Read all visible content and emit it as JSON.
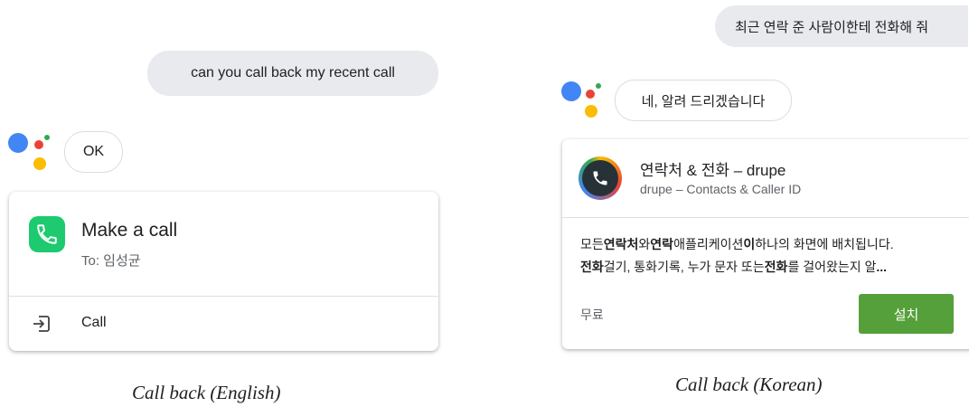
{
  "english": {
    "user_message": "can you call back my recent call",
    "assistant_reply": "OK",
    "card": {
      "icon": "phone-icon",
      "title": "Make a call",
      "subtitle": "To: 임성균",
      "action_icon": "exit-arrow-icon",
      "action_label": "Call"
    },
    "caption": "Call back (English)"
  },
  "korean": {
    "user_message": "최근 연락 준 사람이한테 전화해 줘",
    "assistant_reply": "네, 알려 드리겠습니다",
    "card": {
      "app_icon": "drupe-phone-icon",
      "app_title": "연락처 & 전화 – drupe",
      "app_subtitle": "drupe – Contacts & Caller ID",
      "description_line1": [
        {
          "text": "모든 ",
          "bold": false
        },
        {
          "text": "연락처",
          "bold": true
        },
        {
          "text": "와 ",
          "bold": false
        },
        {
          "text": "연락",
          "bold": true
        },
        {
          "text": " 애플리케이션",
          "bold": false
        },
        {
          "text": "이",
          "bold": true
        },
        {
          "text": " 하나의 화면에 배치됩니다.",
          "bold": false
        }
      ],
      "description_line2": [
        {
          "text": "전화",
          "bold": true
        },
        {
          "text": " 걸기, 통화기록, 누가 문자 또는 ",
          "bold": false
        },
        {
          "text": "전화",
          "bold": true
        },
        {
          "text": "를 걸어왔는지 알 ",
          "bold": false
        },
        {
          "text": "...",
          "bold": true
        }
      ],
      "price_label": "무료",
      "install_button": "설치"
    },
    "caption": "Call back (Korean)"
  },
  "colors": {
    "google_blue": "#4285F4",
    "google_red": "#EA4335",
    "google_yellow": "#FBBC04",
    "google_green": "#34A853",
    "phone_green": "#1DCA70",
    "install_green": "#55A03A",
    "user_bubble": "#e8eaed"
  }
}
